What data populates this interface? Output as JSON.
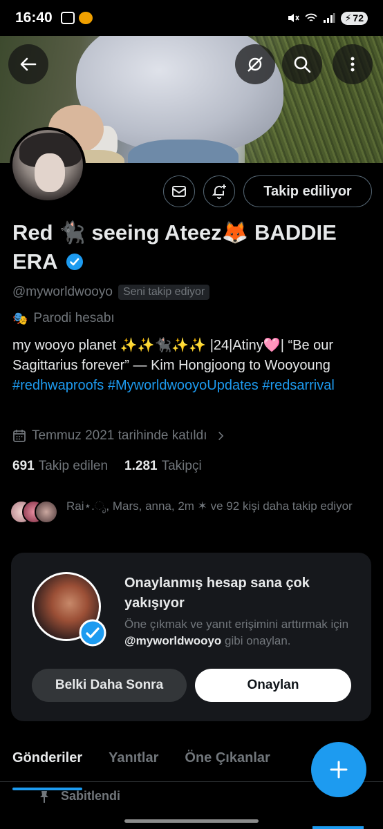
{
  "status_bar": {
    "time": "16:40",
    "battery": "72"
  },
  "profile": {
    "display_name": "Red 🐈‍⬛ seeing Ateez🦊 BADDIE ERA",
    "handle": "@myworldwooyo",
    "follows_you_label": "Seni takip ediyor",
    "parody_label": "Parodi hesabı",
    "bio_text": "my wooyo planet  ✨✨🐈‍⬛✨✨ |24|Atiny🩷| “Be our Sagittarius forever” — Kim Hongjoong to Wooyoung ",
    "hashtags": [
      "#redhwaproofs",
      "#MyworldwooyoUpdates",
      "#redsarrival"
    ],
    "joined": "Temmuz 2021 tarihinde katıldı",
    "following_count": "691",
    "following_label": "Takip edilen",
    "followers_count": "1.281",
    "followers_label": "Takipçi",
    "known_followers": "Rai⋆.ೃ, Mars, anna, 2m ✶ ve 92 kişi daha takip ediyor"
  },
  "actions": {
    "follow_label": "Takip ediliyor"
  },
  "verify_card": {
    "title": "Onaylanmış hesap sana çok yakışıyor",
    "desc_prefix": "Öne çıkmak ve yanıt erişimini arttırmak için ",
    "desc_handle": "@myworldwooyo",
    "desc_suffix": " gibi onaylan.",
    "later_label": "Belki Daha Sonra",
    "verify_label": "Onaylan"
  },
  "tabs": [
    {
      "label": "Gönderiler",
      "active": true
    },
    {
      "label": "Yanıtlar",
      "active": false
    },
    {
      "label": "Öne Çıkanlar",
      "active": false
    }
  ],
  "pinned_label": "Sabitlendi",
  "colors": {
    "accent": "#1d9bf0",
    "background": "#000000",
    "muted": "#71767b",
    "card": "#16181c"
  }
}
